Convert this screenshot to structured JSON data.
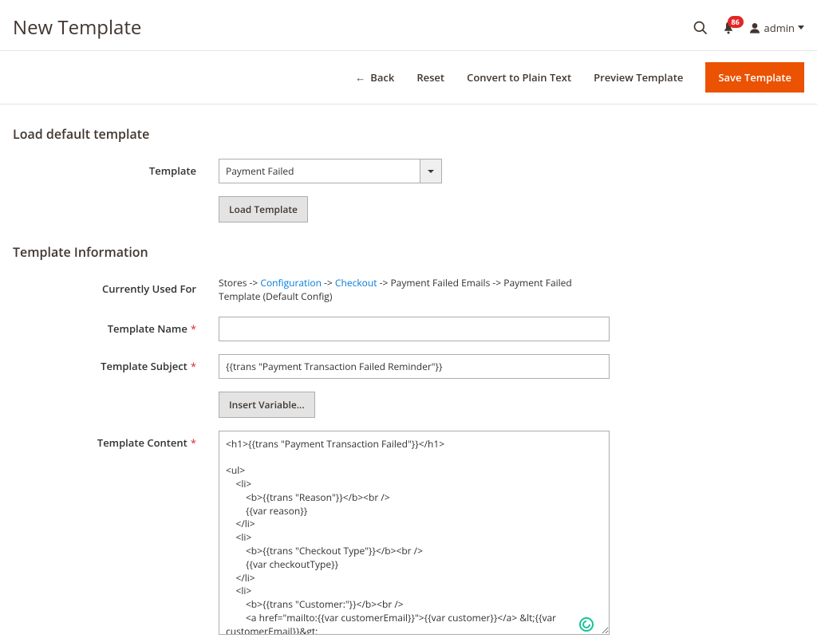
{
  "header": {
    "title": "New Template",
    "notif_count": "86",
    "user_label": "admin"
  },
  "toolbar": {
    "back": "Back",
    "reset": "Reset",
    "convert": "Convert to Plain Text",
    "preview": "Preview Template",
    "save": "Save Template"
  },
  "sections": {
    "load_default": "Load default template",
    "template_info": "Template Information"
  },
  "labels": {
    "template": "Template",
    "load_template": "Load Template",
    "currently_used_for": "Currently Used For",
    "template_name": "Template Name",
    "template_subject": "Template Subject",
    "insert_variable": "Insert Variable...",
    "template_content": "Template Content"
  },
  "values": {
    "template_select": "Payment Failed",
    "template_name": "",
    "template_subject": "{{trans \"Payment Transaction Failed Reminder\"}}",
    "template_content": "<h1>{{trans \"Payment Transaction Failed\"}}</h1>\n\n<ul>\n    <li>\n        <b>{{trans \"Reason\"}}</b><br />\n        {{var reason}}\n    </li>\n    <li>\n        <b>{{trans \"Checkout Type\"}}</b><br />\n        {{var checkoutType}}\n    </li>\n    <li>\n        <b>{{trans \"Customer:\"}}</b><br />\n        <a href=\"mailto:{{var customerEmail}}\">{{var customer}}</a> &lt;{{var customerEmail}}&gt;\n    </li>\n    <li>\n        <b>{{trans \"Items\"}}</b><br />\n        {{var items|raw}}\n    </li>\n    <li>"
  },
  "used_for": {
    "prefix": "Stores -> ",
    "link1": "Configuration",
    "sep1": " -> ",
    "link2": "Checkout",
    "suffix": " -> Payment Failed Emails -> Payment Failed Template  (Default Config)"
  }
}
